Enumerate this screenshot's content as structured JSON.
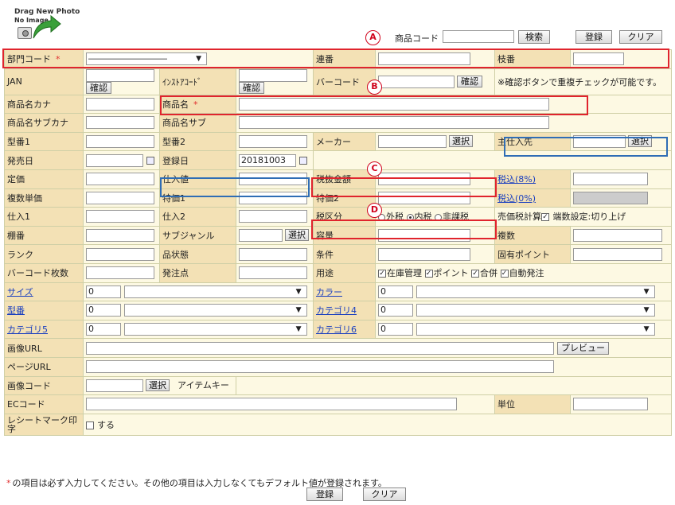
{
  "photo": {
    "line1": "Drag New Photo",
    "line2": "No Image"
  },
  "badges": {
    "a": "A",
    "b": "B",
    "c": "C",
    "d": "D"
  },
  "top": {
    "code_label": "商品コード",
    "search_btn": "検索",
    "register_btn": "登録",
    "clear_btn": "クリア"
  },
  "required_mark": "*",
  "confirm_btn": "確認",
  "select_btn": "選択",
  "labels": {
    "dept": "部門コード",
    "serial": "連番",
    "branch": "枝番",
    "jan": "JAN",
    "instore": "ｲﾝｽﾄｱｺｰﾄﾞ",
    "barcode": "バーコード",
    "dup_note": "※確認ボタンで重複チェックが可能です。",
    "kana": "商品名カナ",
    "name": "商品名",
    "subkana": "商品名サブカナ",
    "sub": "商品名サブ",
    "model1": "型番1",
    "model2": "型番2",
    "maker": "メーカー",
    "supplier": "主仕入先",
    "release": "発売日",
    "regdate": "登録日",
    "list_price": "定価",
    "cost": "仕入値",
    "tax_ex": "税抜金額",
    "tax8": "税込(8%)",
    "multi_price": "複数単価",
    "special1": "特価1",
    "special2": "特価2",
    "tax0": "税込(0%)",
    "purchase1": "仕入1",
    "purchase2": "仕入2",
    "tax_type": "税区分",
    "sale_tax_calc": "売価税計算",
    "rounding": "端数設定:切り上げ",
    "shelf": "棚番",
    "subgenre": "サブジャンル",
    "capacity": "容量",
    "multiple": "複数",
    "rank": "ランク",
    "condition": "品状態",
    "terms": "条件",
    "fixed_points": "固有ポイント",
    "barcode_count": "バーコード枚数",
    "order_point": "発注点",
    "usage": "用途",
    "size": "サイズ",
    "color": "カラー",
    "model": "型番",
    "cat4": "カテゴリ4",
    "cat5": "カテゴリ5",
    "cat6": "カテゴリ6",
    "image_url": "画像URL",
    "page_url": "ページURL",
    "image_code": "画像コード",
    "item_key": "アイテムキー",
    "ec_code": "ECコード",
    "unit": "単位",
    "receipt_mark": "レシートマーク印字",
    "receipt_do": "する"
  },
  "values": {
    "dept_select": "―――――――――",
    "regdate": "20181003",
    "zero": "0"
  },
  "tax_options": [
    "外税",
    "内税",
    "非課税"
  ],
  "usage_options": [
    "在庫管理",
    "ポイント",
    "合併",
    "自動発注"
  ],
  "preview_btn": "プレビュー",
  "footer": {
    "note": "の項目は必ず入力してください。その他の項目は入力しなくてもデフォルト値が登録されます。",
    "register_btn": "登録",
    "clear_btn": "クリア"
  },
  "colors": {
    "label_bg": "#f3e1b5",
    "value_bg": "#fdf9e3",
    "highlight_red": "#e0242d",
    "highlight_blue": "#2f6db5"
  }
}
